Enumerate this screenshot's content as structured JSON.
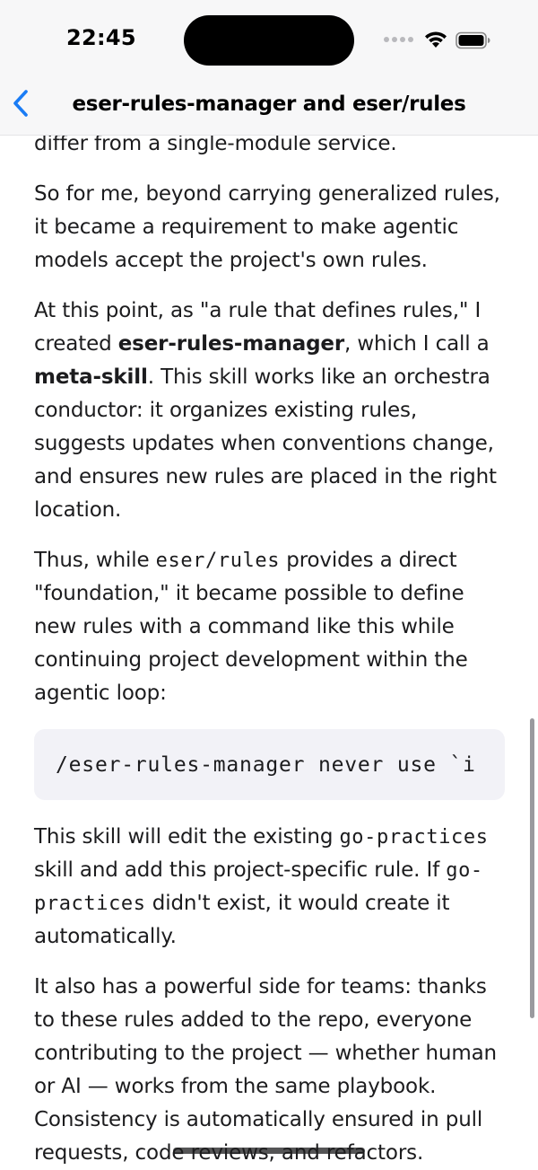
{
  "status_bar": {
    "time": "22:45"
  },
  "nav": {
    "title": "eser-rules-manager and eser/rules",
    "back_icon": "chevron-left-icon",
    "accent_color": "#1a7cf5"
  },
  "article": {
    "p0": "differ from a single-module service.",
    "p1": "So for me, beyond carrying generalized rules, it became a requirement to make agentic models accept the project's own rules.",
    "p2": {
      "before": "At this point, as \"a rule that defines rules,\" I created ",
      "bold1": "eser-rules-manager",
      "middle": ", which I call a ",
      "bold2": "meta-skill",
      "after": ". This skill works like an orchestra conductor: it organizes existing rules, suggests updates when conventions change, and ensures new rules are placed in the right location."
    },
    "p3": {
      "before": "Thus, while ",
      "code": "eser/rules",
      "after": " provides a direct \"foundation,\" it became possible to define new rules with a command like this while continuing project development within the agentic loop:"
    },
    "code_block": "/eser-rules-manager never use `i",
    "p4": {
      "before": "This skill will edit the existing ",
      "code1": "go-practices",
      "middle": " skill and add this project-specific rule. If ",
      "code2": "go-practices",
      "after": " didn't exist, it would create it automatically."
    },
    "p5": "It also has a powerful side for teams: thanks to these rules added to the repo, everyone contributing to the project — whether human or AI — works from the same playbook. Consistency is automatically ensured in pull requests, code reviews, and refactors."
  }
}
